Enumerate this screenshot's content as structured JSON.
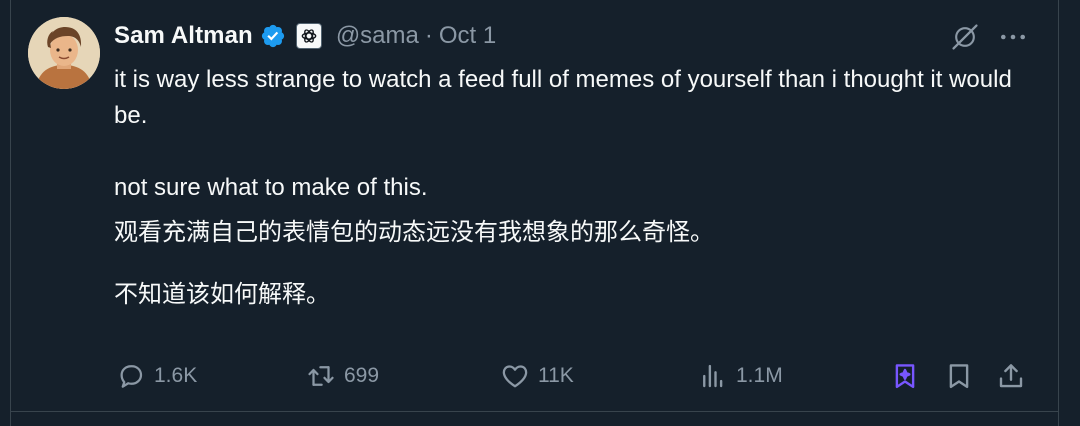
{
  "author": {
    "display_name": "Sam Altman",
    "handle": "@sama",
    "separator": "·",
    "date": "Oct 1",
    "verified_color": "#1d9bf0",
    "affiliation_icon": "openai-logo-icon"
  },
  "tweet": {
    "paragraphs": [
      "it is way less strange to watch a feed full of memes of yourself than i thought it would be.",
      "not sure what to make of this.",
      "观看充满自己的表情包的动态远没有我想象的那么奇怪。",
      "不知道该如何解释。"
    ]
  },
  "actions": {
    "replies": "1.6K",
    "reposts": "699",
    "likes": "11K",
    "views": "1.1M"
  },
  "icons": {
    "top_right": [
      "grok-icon",
      "more-options-icon"
    ],
    "action_bar": [
      "reply-icon",
      "repost-icon",
      "like-icon",
      "views-icon",
      "grok-bookmark-icon",
      "bookmark-icon",
      "share-icon"
    ]
  },
  "colors": {
    "background": "#15202b",
    "text_primary": "#f7f9f9",
    "text_secondary": "#8b98a5",
    "divider": "#38444d",
    "accent_purple": "#7856ff",
    "verified_blue": "#1d9bf0"
  }
}
